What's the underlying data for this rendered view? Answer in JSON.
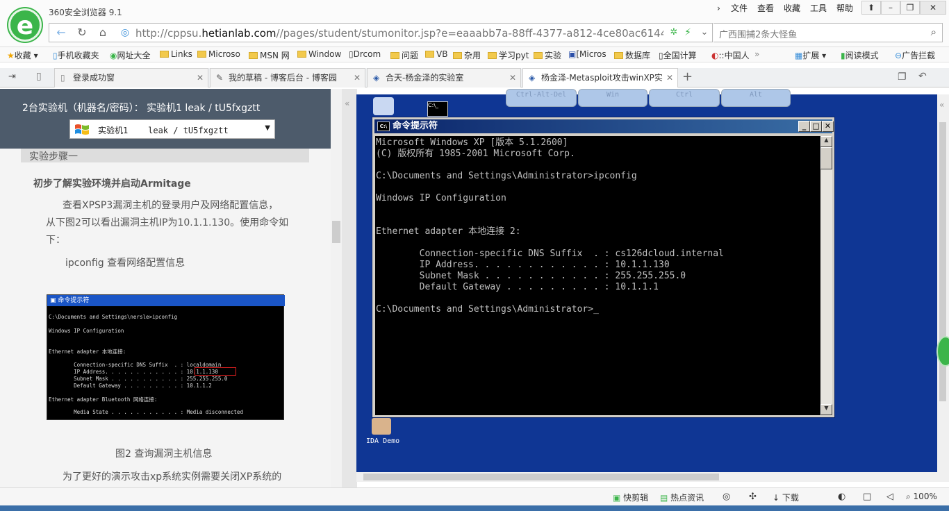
{
  "browser": {
    "title": "360安全浏览器 9.1",
    "menu": [
      "文件",
      "查看",
      "收藏",
      "工具",
      "帮助"
    ],
    "url_prefix": "http://cppsu.",
    "url_domain": "hetianlab.com",
    "url_rest": "//pages/student/stumonitor.jsp?e=eaaabb7a-88ff-4377-a812-4ce80ac6144e",
    "search_placeholder": "广西围捕2条大怪鱼"
  },
  "bookmarks": [
    "收藏",
    "手机收藏夹",
    "网址大全",
    "Links",
    "Microso",
    "MSN 网",
    "Window",
    "Drcom",
    "问题",
    "VB",
    "杂用",
    "学习pyt",
    "实验",
    "[Micros",
    "数据库",
    "全国计算",
    "::中国人",
    "扩展",
    "阅读模式",
    "广告拦截"
  ],
  "tabs": [
    {
      "label": "登录成功窗"
    },
    {
      "label": "我的草稿 - 博客后台 - 博客园"
    },
    {
      "label": "合天-杨金泽的实验室"
    },
    {
      "label": "杨金泽-Metasploit攻击winXP实"
    }
  ],
  "left_panel": {
    "header": "2台实验机（机器名/密码）：  实验机1    leak / tU5fxgztt",
    "select_value": "实验机1    leak / tU5fxgztt",
    "steps_label": "实验步骤一",
    "section_title": "初步了解实验环境并启动Armitage",
    "para1_line1": "查看XPSP3漏洞主机的登录用户及网络配置信息，",
    "para1_line2": "从下图2可以看出漏洞主机IP为10.1.1.130。使用命令如",
    "para1_line3": "下：",
    "command_text": "ipconfig 查看网络配置信息",
    "figure_caption": "图2 查询漏洞主机信息",
    "para2": "为了更好的演示攻击xp系统实例需要关闭XP系统的"
  },
  "thumb": {
    "title": "命令提示符",
    "lines": [
      "C:\\Documents and Settings\\nersle>ipconfig",
      "Windows IP Configuration",
      "Ethernet adapter 本地连接:",
      "        Connection-specific DNS Suffix  . : localdomain",
      "        IP Address. . . . . . . . . . . . : 10.1.1.130",
      "        Subnet Mask . . . . . . . . . . . : 255.255.255.0",
      "        Default Gateway . . . . . . . . . : 10.1.1.2",
      "Ethernet adapter Bluetooth 网络连接:",
      "        Media State . . . . . . . . . . . : Media disconnected"
    ]
  },
  "remote": {
    "overlay_keys": [
      "Ctrl-Alt-Del",
      "Win",
      "Ctrl",
      "Alt"
    ],
    "desktop_icon_label": "IDA Demo",
    "cmd_title": "命令提示符",
    "cmd_lines": [
      "Microsoft Windows XP [版本 5.1.2600]",
      "(C) 版权所有 1985-2001 Microsoft Corp.",
      "",
      "C:\\Documents and Settings\\Administrator>ipconfig",
      "",
      "Windows IP Configuration",
      "",
      "",
      "Ethernet adapter 本地连接 2:",
      "",
      "        Connection-specific DNS Suffix  . : cs126dcloud.internal",
      "        IP Address. . . . . . . . . . . . : 10.1.1.130",
      "        Subnet Mask . . . . . . . . . . . : 255.255.255.0",
      "        Default Gateway . . . . . . . . . : 10.1.1.1",
      "",
      "C:\\Documents and Settings\\Administrator>_"
    ]
  },
  "statusbar": {
    "items": [
      "快剪辑",
      "热点资讯",
      "下载",
      "100%"
    ]
  },
  "colors": {
    "left_header_bg": "#4d5b6b",
    "remote_desktop_bg": "#0f3694",
    "xp_title_start": "#0a246a",
    "logo_green": "#3bb54a"
  }
}
